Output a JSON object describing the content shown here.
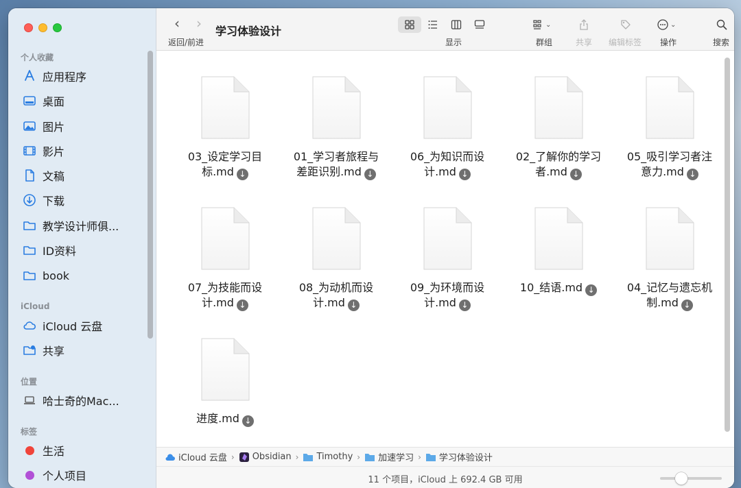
{
  "window": {
    "title": "学习体验设计"
  },
  "toolbar": {
    "nav_label": "返回/前进",
    "view_label": "显示",
    "group_label": "群组",
    "share_label": "共享",
    "tags_label": "编辑标签",
    "action_label": "操作",
    "search_label": "搜索"
  },
  "sidebar": {
    "favorites_header": "个人收藏",
    "favorites": [
      {
        "label": "应用程序",
        "icon": "applications-icon"
      },
      {
        "label": "桌面",
        "icon": "desktop-icon"
      },
      {
        "label": "图片",
        "icon": "pictures-icon"
      },
      {
        "label": "影片",
        "icon": "movies-icon"
      },
      {
        "label": "文稿",
        "icon": "documents-icon"
      },
      {
        "label": "下载",
        "icon": "downloads-icon"
      },
      {
        "label": "教学设计师俱...",
        "icon": "folder-icon"
      },
      {
        "label": "ID资料",
        "icon": "folder-icon"
      },
      {
        "label": "book",
        "icon": "folder-icon"
      }
    ],
    "icloud_header": "iCloud",
    "icloud": [
      {
        "label": "iCloud 云盘",
        "icon": "cloud-icon"
      },
      {
        "label": "共享",
        "icon": "shared-folder-icon"
      }
    ],
    "locations_header": "位置",
    "locations": [
      {
        "label": "哈士奇的Mac...",
        "icon": "laptop-icon"
      }
    ],
    "tags_header": "标签",
    "tags": [
      {
        "label": "生活",
        "color": "#f0443a"
      },
      {
        "label": "个人项目",
        "color": "#b150d6"
      }
    ]
  },
  "files": [
    {
      "line1": "03_设定学习目",
      "line2": "标.md"
    },
    {
      "line1": "01_学习者旅程与",
      "line2": "差距识别.md"
    },
    {
      "line1": "06_为知识而设",
      "line2": "计.md"
    },
    {
      "line1": "02_了解你的学习",
      "line2": "者.md"
    },
    {
      "line1": "05_吸引学习者注",
      "line2": "意力.md"
    },
    {
      "line1": "07_为技能而设",
      "line2": "计.md"
    },
    {
      "line1": "08_为动机而设",
      "line2": "计.md"
    },
    {
      "line1": "09_为环境而设",
      "line2": "计.md"
    },
    {
      "line1": "10_结语.md",
      "line2": ""
    },
    {
      "line1": "04_记忆与遗忘机",
      "line2": "制.md"
    },
    {
      "line1": "进度.md",
      "line2": ""
    }
  ],
  "download_glyph": "↓",
  "pathbar": {
    "crumbs": [
      "iCloud 云盘",
      "Obsidian",
      "Timothy",
      "加速学习",
      "学习体验设计"
    ],
    "separator": "›"
  },
  "status": {
    "text": "11 个项目，iCloud 上 692.4 GB 可用",
    "zoom_level": 0.3
  }
}
